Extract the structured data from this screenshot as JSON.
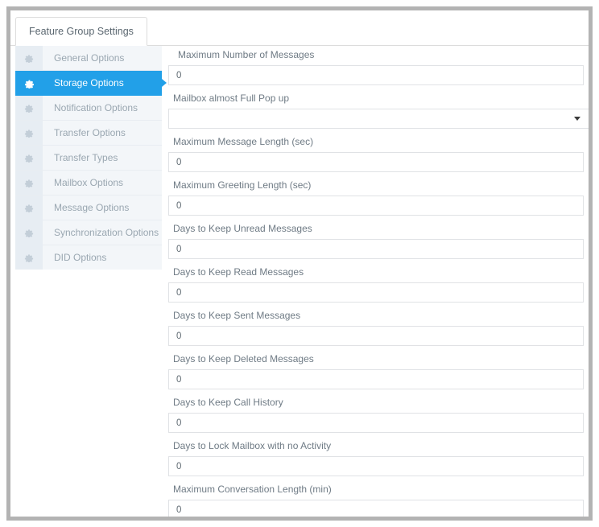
{
  "window": {
    "tab": {
      "label": "Feature Group Settings"
    }
  },
  "sidebar": {
    "icon": "gear-icon",
    "items": [
      {
        "label": "General Options",
        "active": false
      },
      {
        "label": "Storage Options",
        "active": true
      },
      {
        "label": "Notification Options",
        "active": false
      },
      {
        "label": "Transfer Options",
        "active": false
      },
      {
        "label": "Transfer Types",
        "active": false
      },
      {
        "label": "Mailbox Options",
        "active": false
      },
      {
        "label": "Message Options",
        "active": false
      },
      {
        "label": "Synchronization Options",
        "active": false
      },
      {
        "label": "DID Options",
        "active": false
      }
    ]
  },
  "form": {
    "fields": [
      {
        "label": "Maximum Number of Messages",
        "value": "0",
        "type": "text"
      },
      {
        "label": "Mailbox almost Full Pop up",
        "value": "",
        "type": "select"
      },
      {
        "label": "Maximum Message Length (sec)",
        "value": "0",
        "type": "text"
      },
      {
        "label": "Maximum Greeting Length (sec)",
        "value": "0",
        "type": "text"
      },
      {
        "label": "Days to Keep Unread Messages",
        "value": "0",
        "type": "text"
      },
      {
        "label": "Days to Keep Read Messages",
        "value": "0",
        "type": "text"
      },
      {
        "label": "Days to Keep Sent Messages",
        "value": "0",
        "type": "text"
      },
      {
        "label": "Days to Keep Deleted Messages",
        "value": "0",
        "type": "text"
      },
      {
        "label": "Days to Keep Call History",
        "value": "0",
        "type": "text"
      },
      {
        "label": "Days to Lock Mailbox with no Activity",
        "value": "0",
        "type": "text"
      },
      {
        "label": "Maximum Conversation Length (min)",
        "value": "0",
        "type": "text"
      }
    ]
  },
  "colors": {
    "accent": "#22a0e8",
    "frame": "#b3b3b3",
    "sidebar_bg": "#f3f6f9",
    "label_text": "#6f7b85"
  }
}
